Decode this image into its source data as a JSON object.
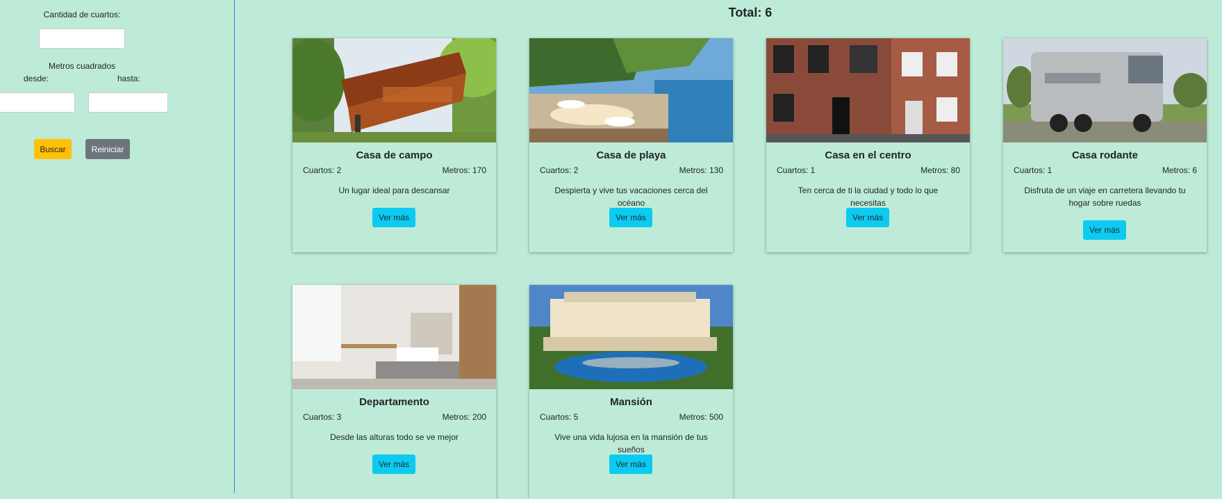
{
  "sidebar": {
    "rooms_label": "Cantidad de cuartos:",
    "rooms_value": "",
    "meters_label": "Metros cuadrados",
    "from_label": "desde:",
    "to_label": "hasta:",
    "from_value": "",
    "to_value": "",
    "search_label": "Buscar",
    "reset_label": "Reiniciar"
  },
  "main": {
    "total": "Total: 6",
    "cards": [
      {
        "title": "Casa de campo",
        "rooms": "Cuartos: 2",
        "meters": "Metros: 170",
        "description": "Un lugar ideal para descansar",
        "button": "Ver más"
      },
      {
        "title": "Casa de playa",
        "rooms": "Cuartos: 2",
        "meters": "Metros: 130",
        "description": "Despierta y vive tus vacaciones cerca del océano",
        "button": "Ver más"
      },
      {
        "title": "Casa en el centro",
        "rooms": "Cuartos: 1",
        "meters": "Metros: 80",
        "description": "Ten cerca de ti la ciudad y todo lo que necesitas",
        "button": "Ver más"
      },
      {
        "title": "Casa rodante",
        "rooms": "Cuartos: 1",
        "meters": "Metros: 6",
        "description": "Disfruta de un viaje en carretera llevando tu hogar sobre ruedas",
        "button": "Ver más"
      },
      {
        "title": "Departamento",
        "rooms": "Cuartos: 3",
        "meters": "Metros: 200",
        "description": "Desde las alturas todo se ve mejor",
        "button": "Ver más"
      },
      {
        "title": "Mansión",
        "rooms": "Cuartos: 5",
        "meters": "Metros: 500",
        "description": "Vive una vida lujosa en la mansión de tus sueños",
        "button": "Ver más"
      }
    ]
  }
}
